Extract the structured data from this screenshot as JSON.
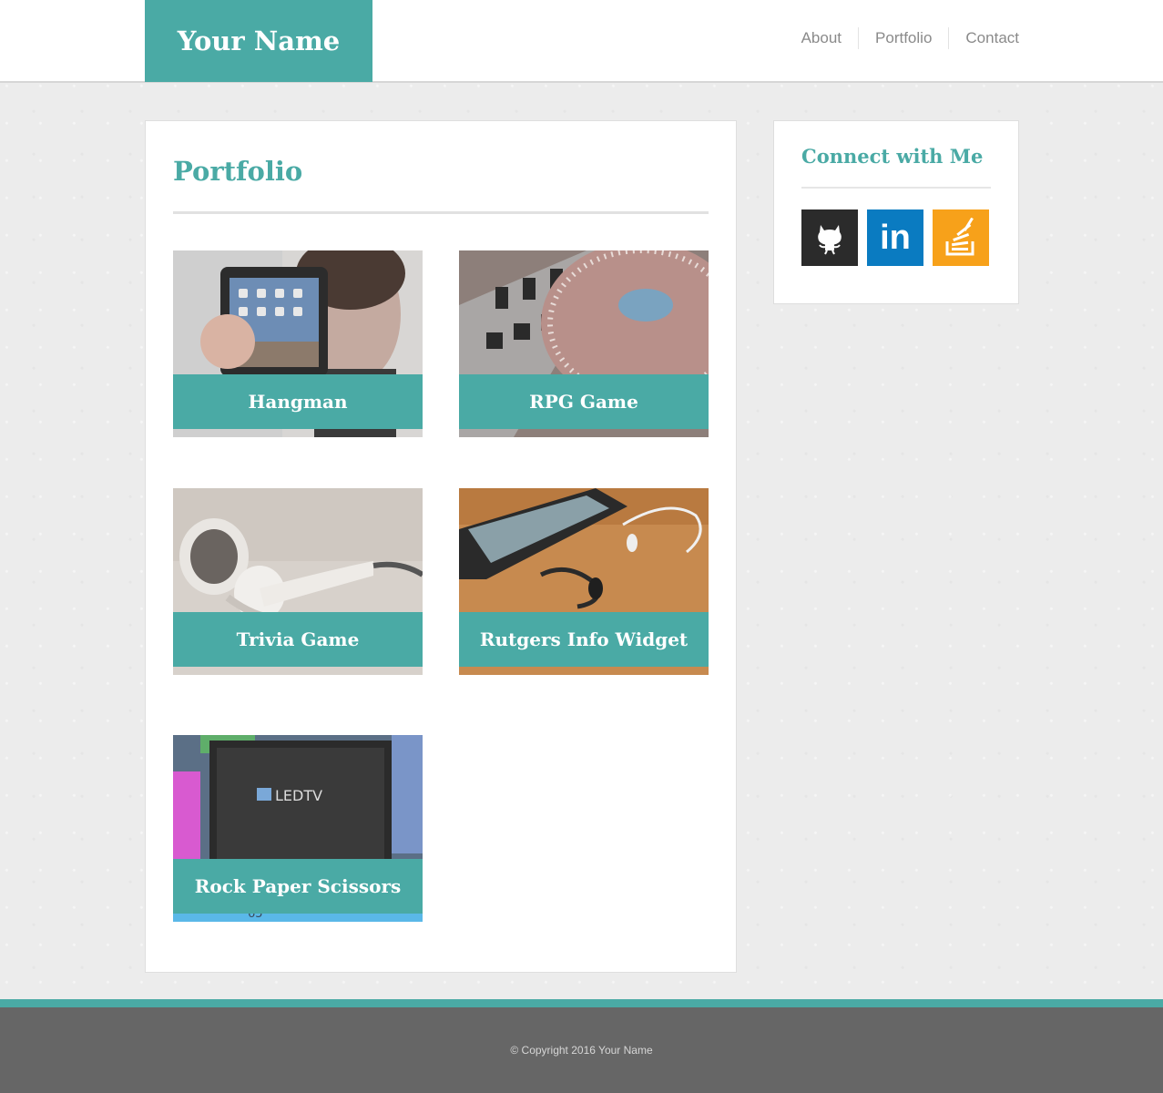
{
  "header": {
    "brand": "Your Name",
    "nav": [
      "About",
      "Portfolio",
      "Contact"
    ]
  },
  "main": {
    "title": "Portfolio",
    "projects": [
      {
        "title": "Hangman",
        "image": "tablet-photo"
      },
      {
        "title": "RPG Game",
        "image": "turntable-photo"
      },
      {
        "title": "Trivia Game",
        "image": "earbuds-photo"
      },
      {
        "title": "Rutgers Info Widget",
        "image": "phone-photo"
      },
      {
        "title": "Rock Paper Scissors",
        "image": "led-tv-photo"
      }
    ],
    "tv_brand": "LEDTV",
    "tv_number": "65"
  },
  "sidebar": {
    "title": "Connect with Me",
    "links": [
      {
        "name": "github-icon",
        "color": "#2b2b2b"
      },
      {
        "name": "linkedin-icon",
        "color": "#0a7bc1",
        "text": "in"
      },
      {
        "name": "stackoverflow-icon",
        "color": "#f7a11a"
      }
    ]
  },
  "footer": {
    "copyright": "© Copyright 2016 Your Name"
  },
  "colors": {
    "accent": "#4aaaa5",
    "footer": "#666666",
    "background": "#ececec"
  }
}
